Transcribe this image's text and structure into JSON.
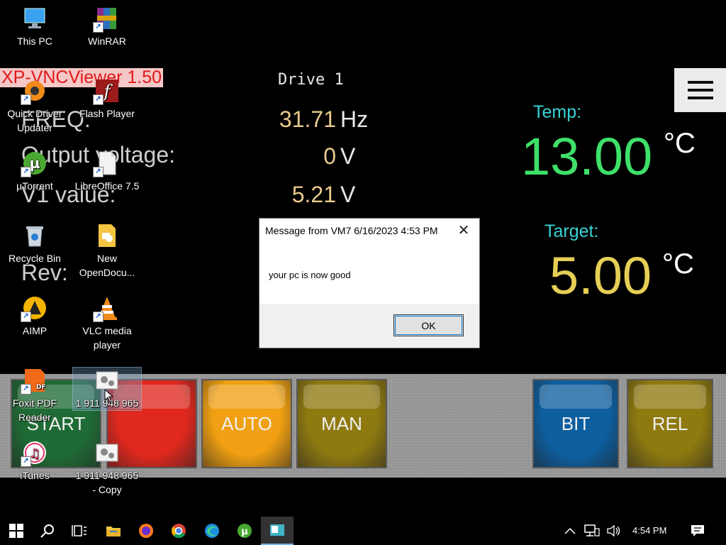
{
  "background_app": {
    "vnc_caption": "XP-VNCViewer 1.50",
    "drive_title": "Drive 1",
    "params": [
      {
        "label": "FREQ:",
        "value": "31.71",
        "unit": "Hz"
      },
      {
        "label": "Output voltage:",
        "value": "0",
        "unit": "V"
      },
      {
        "label": "V1 value:",
        "value": "5.21",
        "unit": "V"
      },
      {
        "label": "Rev:",
        "value": "",
        "unit": ""
      }
    ],
    "temp_label": "Temp:",
    "temp_value": "13.00",
    "target_label": "Target:",
    "target_value": "5.00",
    "unit_c": "°C",
    "buttons": [
      {
        "label": "START",
        "color": "#1f6b35"
      },
      {
        "label": "",
        "color": "#e0281e"
      },
      {
        "label": "AUTO",
        "color": "#f0a012"
      },
      {
        "label": "MAN",
        "color": "#8f7a10"
      },
      {
        "label": "BIT",
        "color": "#0d5fa0"
      },
      {
        "label": "REL",
        "color": "#8f7a10"
      }
    ]
  },
  "desktop_icons": [
    {
      "label": "This PC",
      "icon": "computer-icon"
    },
    {
      "label": "WinRAR",
      "icon": "winrar-icon"
    },
    {
      "label": "Quick Driver Updater",
      "icon": "quick-driver-updater-icon"
    },
    {
      "label": "Flash Player",
      "icon": "flash-player-icon"
    },
    {
      "label": "µTorrent",
      "icon": "utorrent-icon"
    },
    {
      "label": "LibreOffice 7.5",
      "icon": "libreoffice-icon"
    },
    {
      "label": "Recycle Bin",
      "icon": "recycle-bin-icon"
    },
    {
      "label": "New OpenDocu...",
      "icon": "opendocument-icon"
    },
    {
      "label": "AIMP",
      "icon": "aimp-icon"
    },
    {
      "label": "VLC media player",
      "icon": "vlc-icon"
    },
    {
      "label": "Foxit PDF Reader",
      "icon": "foxit-pdf-icon"
    },
    {
      "label": "1 911 948 965",
      "icon": "settings-file-icon"
    },
    {
      "label": "iTunes",
      "icon": "itunes-icon"
    },
    {
      "label": "1 911 948 965 - Copy",
      "icon": "settings-file-icon"
    }
  ],
  "dialog": {
    "title": "Message from VM7 6/16/2023 4:53 PM",
    "message": "your pc is now good",
    "ok_label": "OK",
    "close_glyph": "✕"
  },
  "taskbar": {
    "time": "4:54 PM",
    "pinned": [
      "start-icon",
      "search-icon",
      "task-view-icon",
      "file-explorer-icon",
      "firefox-icon",
      "chrome-icon",
      "edge-icon",
      "utorrent-icon",
      "vnc-viewer-icon"
    ],
    "tray": [
      "chevron-up-icon",
      "network-icon",
      "volume-icon",
      "notifications-icon"
    ]
  },
  "colors": {
    "temp_green": "#3ee06a",
    "target_yellow": "#e6cf55",
    "label_cyan": "#39d3d6"
  }
}
